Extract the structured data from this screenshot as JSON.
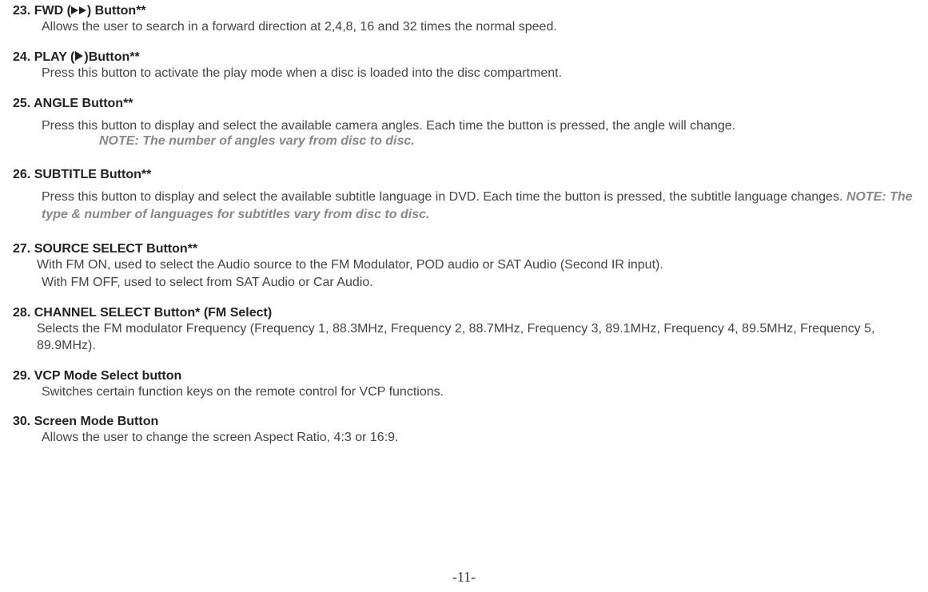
{
  "s23": {
    "heading_pre": "23. FWD (",
    "heading_post": ") Button**",
    "body": "Allows the user to search in a forward direction at 2,4,8, 16 and 32 times the normal speed."
  },
  "s24": {
    "heading_pre": "24.  PLAY (",
    "heading_post": ")Button**",
    "body": "Press this button to activate the play mode when a disc is loaded into the disc compartment."
  },
  "s25": {
    "heading": "25.  ANGLE Button**",
    "body": "Press this button to display and select the available camera angles.  Each time the button is pressed, the angle will change.",
    "note": "NOTE: The number of angles vary from disc to disc."
  },
  "s26": {
    "heading": "26.  SUBTITLE Button**",
    "body_pre": "Press this button to display and select the available subtitle language in DVD.  Each time the button is pressed, the subtitle language changes.  ",
    "note": "NOTE: The type & number of languages for subtitles vary from disc to disc."
  },
  "s27": {
    "heading": "27. SOURCE SELECT Button**",
    "body1": "With FM ON, used to select the Audio source to the FM Modulator, POD audio or SAT Audio (Second IR input).",
    "body2": "With FM OFF, used to select from SAT Audio or Car Audio."
  },
  "s28": {
    "heading": "28. CHANNEL SELECT Button*  (FM Select)",
    "body": "Selects the FM modulator Frequency (Frequency 1, 88.3MHz, Frequency 2, 88.7MHz, Frequency 3, 89.1MHz, Frequency 4, 89.5MHz, Frequency 5, 89.9MHz)."
  },
  "s29": {
    "heading": "29.  VCP Mode Select button",
    "body": "Switches certain function keys on the remote control for VCP functions."
  },
  "s30": {
    "heading": "30. Screen Mode Button",
    "body": "Allows the user to change the screen Aspect Ratio, 4:3 or 16:9."
  },
  "page_number": "-11-"
}
